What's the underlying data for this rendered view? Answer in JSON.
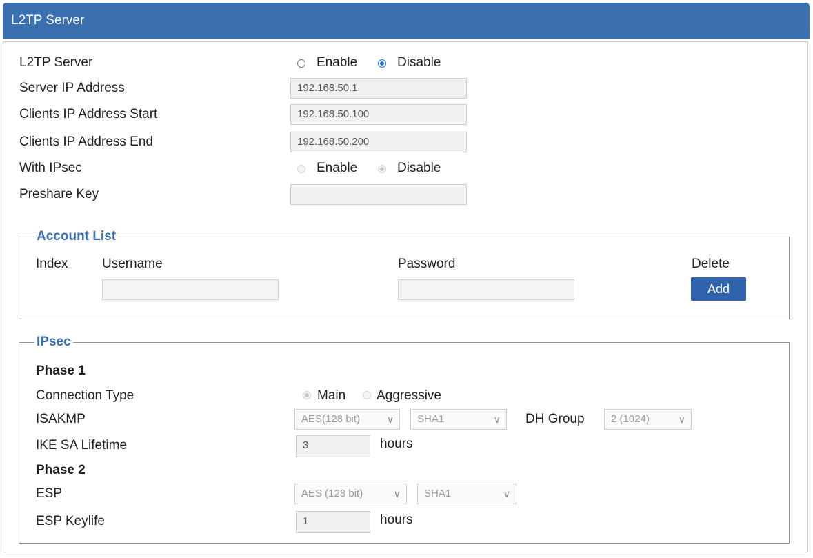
{
  "header": {
    "title": "L2TP Server"
  },
  "server": {
    "l2tp_label": "L2TP Server",
    "enable_label": "Enable",
    "disable_label": "Disable",
    "server_ip_label": "Server IP Address",
    "server_ip_value": "192.168.50.1",
    "client_start_label": "Clients IP Address Start",
    "client_start_value": "192.168.50.100",
    "client_end_label": "Clients IP Address End",
    "client_end_value": "192.168.50.200",
    "ipsec_label": "With IPsec",
    "preshare_label": "Preshare Key",
    "preshare_value": ""
  },
  "accounts": {
    "legend": "Account List",
    "col_index": "Index",
    "col_username": "Username",
    "col_password": "Password",
    "col_delete": "Delete",
    "add_label": "Add"
  },
  "ipsec": {
    "legend": "IPsec",
    "phase1": "Phase 1",
    "connection_type_label": "Connection Type",
    "main_label": "Main",
    "aggressive_label": "Aggressive",
    "isakmp_label": "ISAKMP",
    "isakmp_enc": "AES(128 bit)",
    "isakmp_hash": "SHA1",
    "dh_group_label": "DH Group",
    "dh_group_value": "2 (1024)",
    "ike_lifetime_label": "IKE SA Lifetime",
    "ike_lifetime_value": "3",
    "hours_label": "hours",
    "phase2": "Phase 2",
    "esp_label": "ESP",
    "esp_enc": "AES (128 bit)",
    "esp_hash": "SHA1",
    "esp_keylife_label": "ESP Keylife",
    "esp_keylife_value": "1"
  },
  "colors": {
    "header": "#3a6fb0",
    "button": "#2f64ad",
    "legend": "#3a6fb0",
    "radio_on": "#1a73e8"
  },
  "icons": {
    "select_arrow": "chevron-down-icon"
  }
}
